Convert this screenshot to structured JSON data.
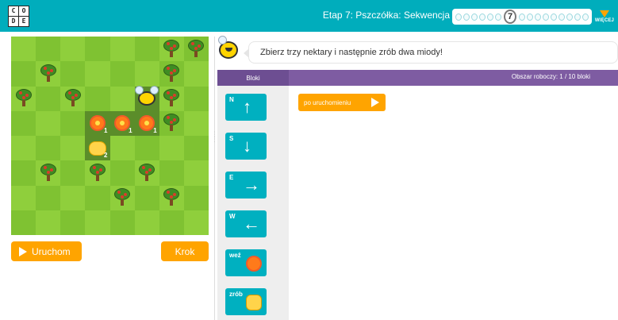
{
  "header": {
    "logo_letters": [
      "C",
      "O",
      "D",
      "E"
    ],
    "stage_title": "Etap 7: Pszczółka: Sekwencja",
    "current_level": "7",
    "more_label": "WIĘCEJ",
    "progress_dots_before": 6,
    "progress_dots_after": 9
  },
  "colors": {
    "header": "#00adbc",
    "run_button": "#ffa400",
    "toolbox_bar": "#7e5ca2",
    "motion_block": "#00b0c0",
    "grid_light": "#8fcf3c",
    "grid_dark": "#7fc232"
  },
  "play_controls": {
    "run_label": "Uruchom",
    "step_label": "Krok"
  },
  "instruction": {
    "text": "Zbierz trzy nektary i następnie zrób dwa miody!"
  },
  "workspace_header": {
    "blocks_label": "Bloki",
    "workspace_label": "Obszar roboczy: 1 / 10 bloki"
  },
  "toolbox": {
    "blocks": [
      {
        "label": "N",
        "icon": "arrow-up-icon",
        "glyph": "↑"
      },
      {
        "label": "S",
        "icon": "arrow-down-icon",
        "glyph": "↓"
      },
      {
        "label": "E",
        "icon": "arrow-right-icon",
        "glyph": "→"
      },
      {
        "label": "W",
        "icon": "arrow-left-icon",
        "glyph": "←"
      },
      {
        "label": "weź",
        "icon": "flower-icon"
      },
      {
        "label": "zrób",
        "icon": "honeycomb-icon"
      }
    ]
  },
  "workspace": {
    "start_block_label": "po uruchomieniu"
  },
  "maze": {
    "rows": [
      [
        "",
        "",
        "",
        "",
        "",
        "",
        "tree",
        "tree"
      ],
      [
        "",
        "tree",
        "",
        "",
        "",
        "",
        "tree",
        ""
      ],
      [
        "tree",
        "",
        "tree",
        "",
        "",
        "bee",
        "tree",
        ""
      ],
      [
        "",
        "",
        "",
        "flower",
        "flower",
        "flower",
        "tree",
        ""
      ],
      [
        "",
        "",
        "",
        "honey",
        "",
        "",
        "",
        ""
      ],
      [
        "",
        "tree",
        "",
        "tree",
        "",
        "tree",
        "",
        ""
      ],
      [
        "",
        "",
        "",
        "",
        "tree",
        "",
        "tree",
        ""
      ],
      [
        "",
        "",
        "",
        "",
        "",
        "",
        "",
        ""
      ]
    ],
    "flower_count": "1",
    "honey_count": "2"
  }
}
